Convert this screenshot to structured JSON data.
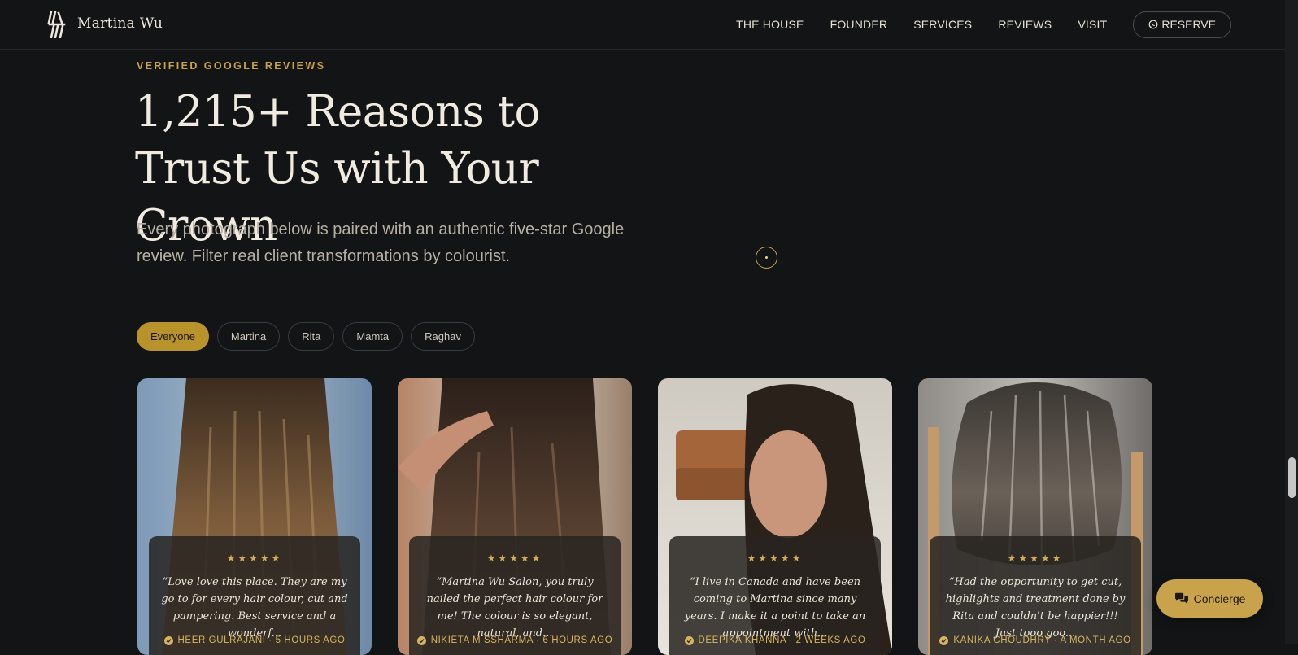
{
  "brand": {
    "name": "Martina Wu",
    "logo_icon": "mw-monogram-icon"
  },
  "nav": {
    "links": [
      "THE HOUSE",
      "FOUNDER",
      "SERVICES",
      "REVIEWS",
      "VISIT"
    ],
    "reserve_label": "RESERVE",
    "reserve_icon": "whatsapp-icon"
  },
  "page_progress": 0.76,
  "section": {
    "eyebrow": "VERIFIED GOOGLE REVIEWS",
    "headline": "1,215+ Reasons to Trust Us with Your Crown",
    "subtitle": "Every photograph below is paired with an authentic five-star Google review. Filter real client transformations by colourist."
  },
  "filters": [
    {
      "label": "Everyone",
      "active": true
    },
    {
      "label": "Martina",
      "active": false
    },
    {
      "label": "Rita",
      "active": false
    },
    {
      "label": "Mamta",
      "active": false
    },
    {
      "label": "Raghav",
      "active": false
    }
  ],
  "reviews": [
    {
      "stars": "★★★★★",
      "quote": "“Love love this place. They are my go to for every hair colour, cut and pampering. Best service and a wonderf...",
      "author": "HEER GULRAJANI · 5 HOURS AGO"
    },
    {
      "stars": "★★★★★",
      "quote": "“Martina Wu Salon, you truly nailed the perfect hair colour for me! The colour is so elegant, natural, and...",
      "author": "NIKIETA M SSHARMA · 6 HOURS AGO"
    },
    {
      "stars": "★★★★★",
      "quote": "“I live in Canada and have been coming to Martina since many years. I make it a point to take an appointment with...",
      "author": "DEEPIKA KHANNA · 2 WEEKS AGO"
    },
    {
      "stars": "★★★★★",
      "quote": "“Had the opportunity to get cut, highlights and treatment done by Rita and couldn't be happier!!! Just tooo goo...",
      "author": "KANIKA CHOUDHRY · A MONTH AGO"
    }
  ],
  "concierge": {
    "label": "Concierge",
    "icon": "chat-bubbles-icon"
  },
  "colors": {
    "accent": "#c9a24a",
    "background": "#131416",
    "text": "#ece6da"
  }
}
